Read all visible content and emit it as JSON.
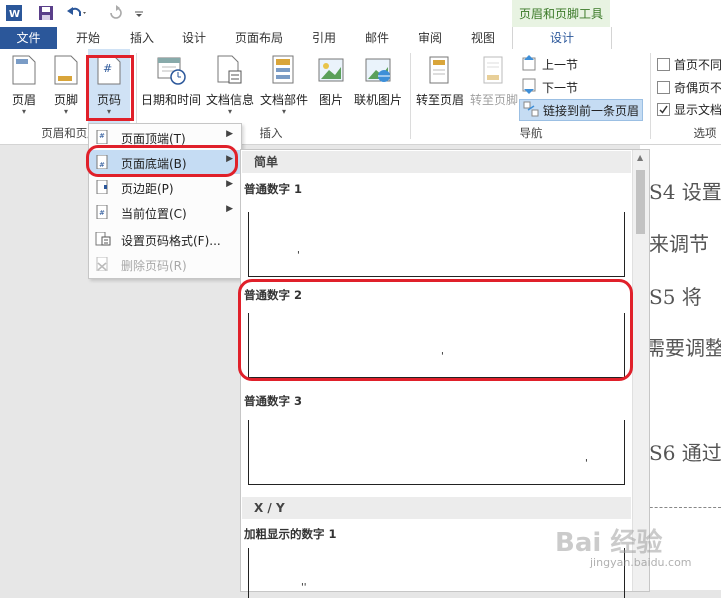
{
  "title_bar": {
    "context_tool_header": "页眉和页脚工具",
    "quick_access": [
      "word-logo-icon",
      "save-icon",
      "undo-icon",
      "redo-icon",
      "customize-icon"
    ]
  },
  "tabs": {
    "file": "文件",
    "home": "开始",
    "insert": "插入",
    "design": "设计",
    "layout": "页面布局",
    "references": "引用",
    "mailings": "邮件",
    "review": "审阅",
    "view": "视图",
    "active": "设计"
  },
  "ribbon": {
    "header": "页眉",
    "footer": "页脚",
    "page_number": "页码",
    "date_time": "日期和时间",
    "doc_info": "文档信息",
    "doc_parts": "文档部件",
    "picture": "图片",
    "online_picture": "联机图片",
    "goto_header": "转至页眉",
    "goto_footer": "转至页脚",
    "prev_section": "上一节",
    "next_section": "下一节",
    "link_prev": "链接到前一条页眉",
    "diff_first": "首页不同",
    "diff_odd_even": "奇偶页不",
    "show_doc_text": "显示文档",
    "group_header_footer": "页眉和页脚",
    "group_insert": "插入",
    "group_navigation": "导航",
    "group_options": "选项"
  },
  "menu": {
    "items": [
      {
        "label": "页面顶端(T)",
        "has_submenu": true
      },
      {
        "label": "页面底端(B)",
        "has_submenu": true
      },
      {
        "label": "页边距(P)",
        "has_submenu": true
      },
      {
        "label": "当前位置(C)",
        "has_submenu": true
      },
      {
        "label": "设置页码格式(F)...",
        "has_submenu": false
      },
      {
        "label": "删除页码(R)",
        "has_submenu": false
      }
    ]
  },
  "gallery": {
    "section_simple": "简单",
    "section_xy": "X / Y",
    "items": [
      "普通数字 1",
      "普通数字 2",
      "普通数字 3",
      "加粗显示的数字 1"
    ]
  },
  "document": {
    "lines": [
      "S4 设置",
      "来调节",
      "S5 将",
      "需要调整",
      "S6 通过"
    ]
  },
  "watermark": {
    "brand": "Bai 经验",
    "url": "jingyan.baidu.com"
  },
  "colors": {
    "file_tab": "#2b579a",
    "context_header": "#3b7a28",
    "highlight": "#c5dcf3",
    "annotation_red": "#e0202a"
  }
}
